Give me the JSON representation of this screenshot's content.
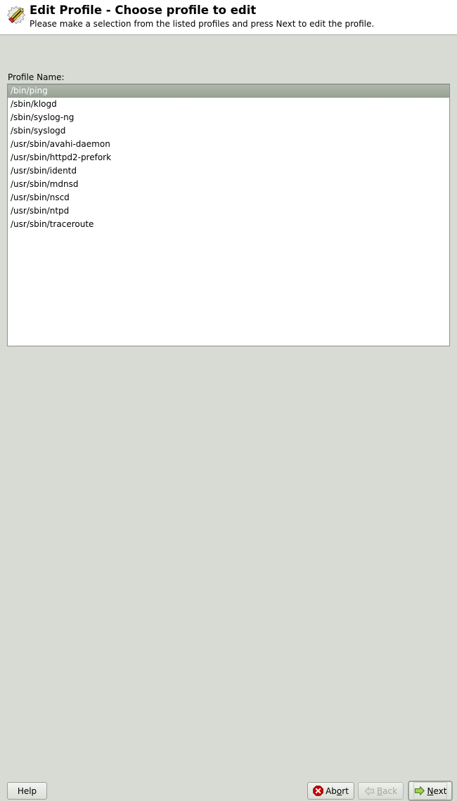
{
  "header": {
    "icon": "edit-profile-pencil-icon",
    "title": "Edit Profile - Choose profile to edit",
    "subtitle": "Please make a selection from the listed profiles and press Next to edit the profile."
  },
  "main": {
    "list_label": "Profile Name:",
    "profiles": [
      {
        "name": "/bin/ping",
        "selected": true
      },
      {
        "name": "/sbin/klogd",
        "selected": false
      },
      {
        "name": "/sbin/syslog-ng",
        "selected": false
      },
      {
        "name": "/sbin/syslogd",
        "selected": false
      },
      {
        "name": "/usr/sbin/avahi-daemon",
        "selected": false
      },
      {
        "name": "/usr/sbin/httpd2-prefork",
        "selected": false
      },
      {
        "name": "/usr/sbin/identd",
        "selected": false
      },
      {
        "name": "/usr/sbin/mdnsd",
        "selected": false
      },
      {
        "name": "/usr/sbin/nscd",
        "selected": false
      },
      {
        "name": "/usr/sbin/ntpd",
        "selected": false
      },
      {
        "name": "/usr/sbin/traceroute",
        "selected": false
      }
    ]
  },
  "footer": {
    "help_label": "Help",
    "abort_label": "Abort",
    "abort_icon": "abort-stop-icon",
    "back_label": "Back",
    "back_icon": "arrow-left-icon",
    "back_disabled": true,
    "next_label": "Next",
    "next_icon": "arrow-right-icon",
    "next_focused": true
  },
  "colors": {
    "window_background": "#d7dbd3",
    "header_background": "#ffffff",
    "list_background": "#ffffff",
    "selection_background": "#a3aca0",
    "selection_text": "#ffffff",
    "abort_icon_color": "#cc0000",
    "next_icon_color": "#7cb342",
    "border": "#8d918a"
  }
}
